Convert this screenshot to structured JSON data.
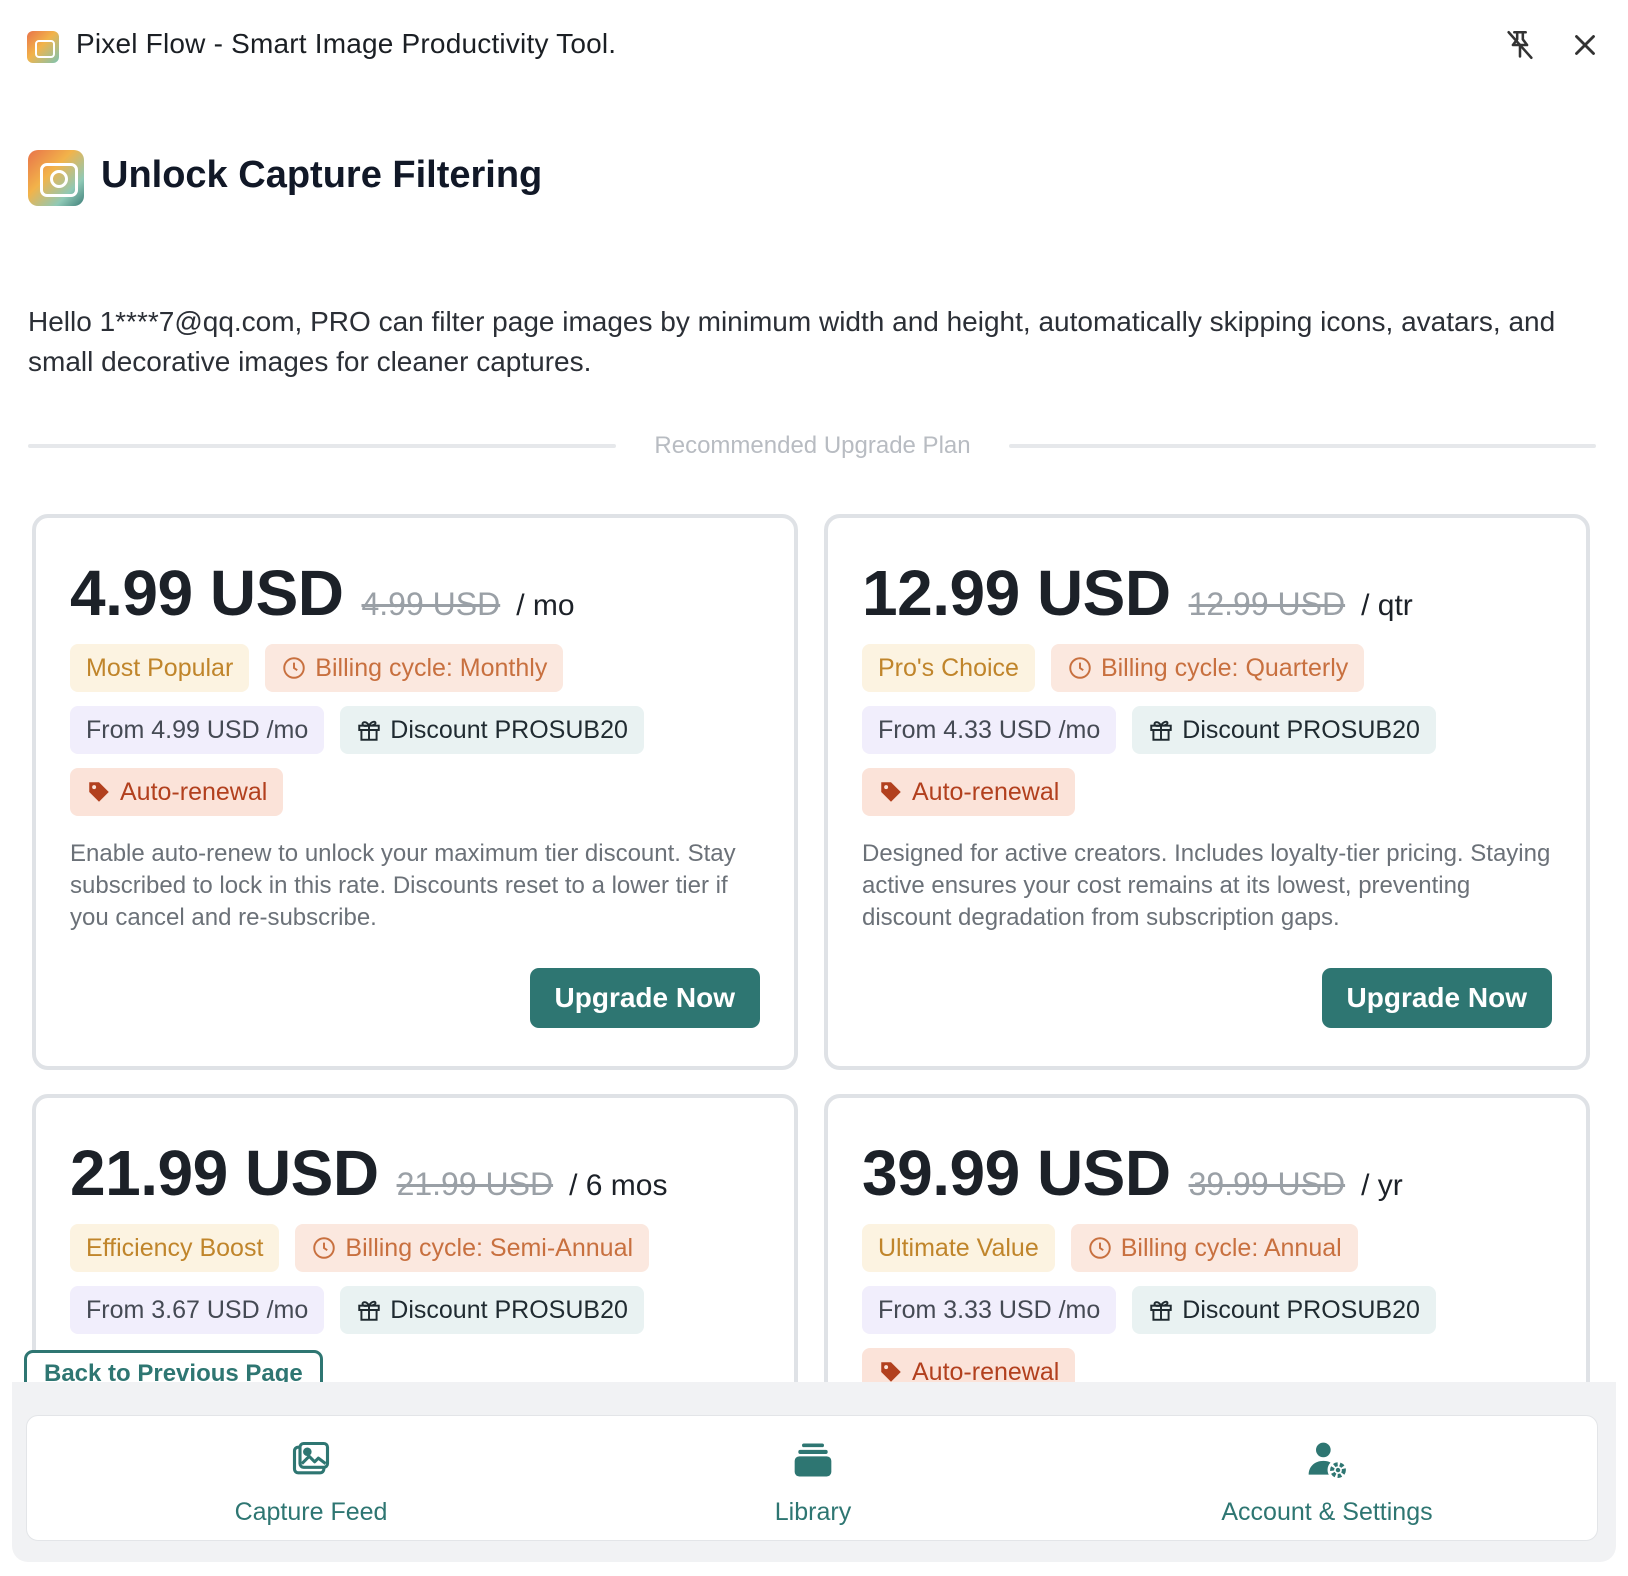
{
  "window": {
    "title": "Pixel Flow - Smart Image Productivity Tool."
  },
  "header": {
    "title": "Unlock Capture Filtering"
  },
  "intro": "Hello 1****7@qq.com, PRO can filter page images by minimum width and height, automatically skipping icons, avatars, and small decorative images for cleaner captures.",
  "divider_label": "Recommended Upgrade Plan",
  "plans": [
    {
      "price": "4.99 USD",
      "old_price": "4.99 USD",
      "period": "/ mo",
      "tag": "Most Popular",
      "cycle": "Billing cycle: Monthly",
      "from": "From 4.99 USD /mo",
      "discount": "Discount PROSUB20",
      "auto": "Auto-renewal",
      "description": "Enable auto-renew to unlock your maximum tier discount. Stay subscribed to lock in this rate. Discounts reset to a lower tier if you cancel and re-subscribe.",
      "button": "Upgrade Now"
    },
    {
      "price": "12.99 USD",
      "old_price": "12.99 USD",
      "period": "/ qtr",
      "tag": "Pro's Choice",
      "cycle": "Billing cycle: Quarterly",
      "from": "From 4.33 USD /mo",
      "discount": "Discount PROSUB20",
      "auto": "Auto-renewal",
      "description": "Designed for active creators. Includes loyalty-tier pricing. Staying active ensures your cost remains at its lowest, preventing discount degradation from subscription gaps.",
      "button": "Upgrade Now"
    },
    {
      "price": "21.99 USD",
      "old_price": "21.99 USD",
      "period": "/ 6 mos",
      "tag": "Efficiency Boost",
      "cycle": "Billing cycle: Semi-Annual",
      "from": "From 3.67 USD /mo",
      "discount": "Discount PROSUB20"
    },
    {
      "price": "39.99 USD",
      "old_price": "39.99 USD",
      "period": "/ yr",
      "tag": "Ultimate Value",
      "cycle": "Billing cycle: Annual",
      "from": "From 3.33 USD /mo",
      "discount": "Discount PROSUB20",
      "auto": "Auto-renewal"
    }
  ],
  "back_button": "Back to Previous Page",
  "nav": [
    {
      "label": "Capture Feed",
      "icon": "image-icon"
    },
    {
      "label": "Library",
      "icon": "stack-icon"
    },
    {
      "label": "Account & Settings",
      "icon": "user-settings-icon"
    }
  ],
  "colors": {
    "accent": "#2e7672",
    "tag_bg": "#fcf3e1",
    "cycle_bg": "#fbe8df",
    "auto_bg": "#fbe3d9"
  }
}
